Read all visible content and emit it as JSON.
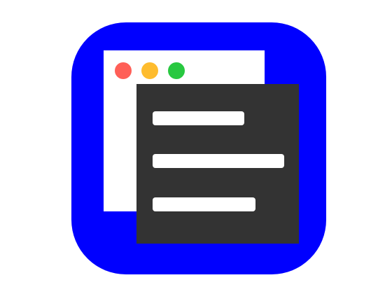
{
  "icon": {
    "name": "text-editor-app-icon",
    "colors": {
      "background": "#0000ff",
      "window": "#ffffff",
      "panel": "#333333",
      "lines": "#ffffff",
      "dot_red": "#ff5f57",
      "dot_yellow": "#febc2e",
      "dot_green": "#28c840"
    },
    "window_dots": [
      "red",
      "yellow",
      "green"
    ],
    "text_lines": 3
  }
}
